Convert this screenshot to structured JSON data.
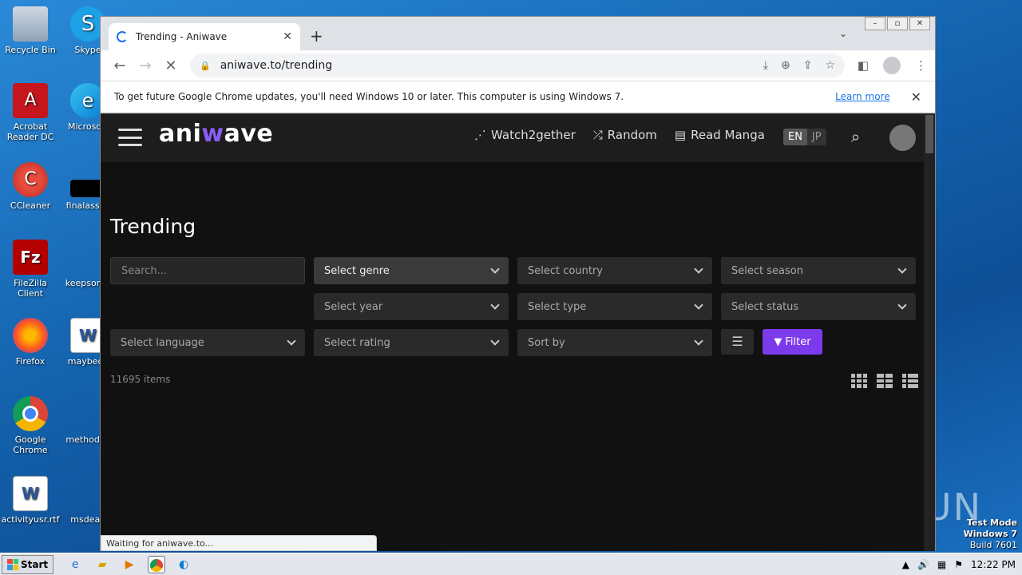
{
  "desktop": {
    "icons": [
      {
        "label": "Recycle Bin",
        "glyph": "🗑"
      },
      {
        "label": "Skype",
        "glyph": "S"
      },
      {
        "label": "Acrobat Reader DC",
        "glyph": "A"
      },
      {
        "label": "Microsoft",
        "glyph": "e"
      },
      {
        "label": "CCleaner",
        "glyph": "C"
      },
      {
        "label": "finalassoc",
        "glyph": ""
      },
      {
        "label": "FileZilla Client",
        "glyph": "Fz"
      },
      {
        "label": "keepsome",
        "glyph": ""
      },
      {
        "label": "Firefox",
        "glyph": "🦊"
      },
      {
        "label": "maybeca",
        "glyph": "W"
      },
      {
        "label": "Google Chrome",
        "glyph": "◉"
      },
      {
        "label": "methodsp",
        "glyph": ""
      },
      {
        "label": "activityusr.rtf",
        "glyph": "W"
      },
      {
        "label": "msdeal.",
        "glyph": ""
      }
    ],
    "watermark": "ANY ▷ RUN",
    "test_mode": {
      "line1": "Test Mode",
      "line2": "Windows 7",
      "line3": "Build 7601"
    }
  },
  "browser": {
    "tab_title": "Trending - Aniwave",
    "url": "aniwave.to/trending",
    "infobar_message": "To get future Google Chrome updates, you'll need Windows 10 or later. This computer is using Windows 7.",
    "infobar_link": "Learn more",
    "status_text": "Waiting for aniwave.to..."
  },
  "site": {
    "logo_prefix": "ani",
    "logo_w": "w",
    "logo_suffix": "ave",
    "nav": [
      {
        "label": "Watch2gether",
        "icon": "share-nodes-icon",
        "glyph": "⋰"
      },
      {
        "label": "Random",
        "icon": "shuffle-icon",
        "glyph": "⤮"
      },
      {
        "label": "Read Manga",
        "icon": "book-icon",
        "glyph": "▤"
      }
    ],
    "lang_en": "EN",
    "lang_jp": "JP",
    "page_title": "Trending",
    "filters": {
      "search_placeholder": "Search...",
      "genre": "Select genre",
      "country": "Select country",
      "season": "Select season",
      "year": "Select year",
      "type": "Select type",
      "status": "Select status",
      "language": "Select language",
      "rating": "Select rating",
      "sort": "Sort by",
      "filter_button": "Filter"
    },
    "item_count": "11695 items"
  },
  "taskbar": {
    "start_label": "Start",
    "clock": "12:22 PM"
  },
  "colors": {
    "accent": "#7c3aed",
    "page_bg": "#111111",
    "header_bg": "#1d1d1d"
  }
}
